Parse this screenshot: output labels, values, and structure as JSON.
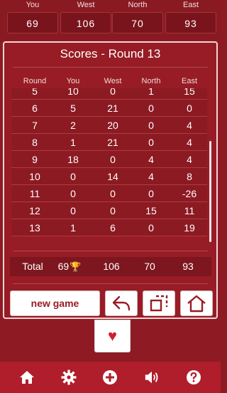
{
  "players": [
    {
      "name": "You",
      "score": "69"
    },
    {
      "name": "West",
      "score": "106"
    },
    {
      "name": "North",
      "score": "70"
    },
    {
      "name": "East",
      "score": "93"
    }
  ],
  "modal": {
    "title": "Scores - Round 13",
    "columns": [
      "Round",
      "You",
      "West",
      "North",
      "East"
    ],
    "rows": [
      [
        "5",
        "10",
        "0",
        "1",
        "15"
      ],
      [
        "6",
        "5",
        "21",
        "0",
        "0"
      ],
      [
        "7",
        "2",
        "20",
        "0",
        "4"
      ],
      [
        "8",
        "1",
        "21",
        "0",
        "4"
      ],
      [
        "9",
        "18",
        "0",
        "4",
        "4"
      ],
      [
        "10",
        "0",
        "14",
        "4",
        "8"
      ],
      [
        "11",
        "0",
        "0",
        "0",
        "-26"
      ],
      [
        "12",
        "0",
        "0",
        "15",
        "11"
      ],
      [
        "13",
        "1",
        "6",
        "0",
        "19"
      ]
    ],
    "total": {
      "label": "Total",
      "you": "69",
      "west": "106",
      "north": "70",
      "east": "93"
    },
    "buttons": {
      "new_game": "new game"
    }
  },
  "icons": {
    "trophy": "trophy-icon",
    "undo": "undo-icon",
    "copy": "copy-icon",
    "home": "home-icon",
    "card_suit": "heart"
  },
  "colors": {
    "background": "#8e1b23",
    "modal": "#971c25",
    "bottom_bar": "#b01d2b",
    "accent": "#9a1a24",
    "heart": "#d11f2e",
    "trophy": "#f3b62a"
  }
}
